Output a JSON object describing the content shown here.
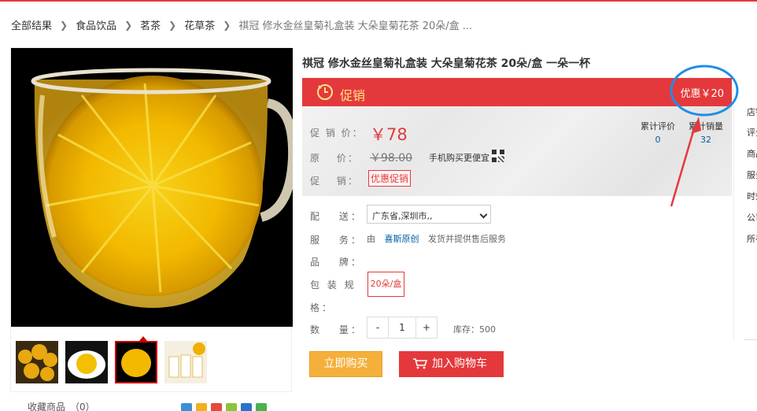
{
  "breadcrumb": [
    "全部结果",
    "食品饮品",
    "茗茶",
    "花草茶",
    "祺冠 修水金丝皇菊礼盒装 大朵皇菊花茶 20朵/盒 ..."
  ],
  "product": {
    "title": "祺冠 修水金丝皇菊礼盒装 大朵皇菊花茶 20朵/盒 一朵一杯",
    "promo_label": "促销",
    "discount_badge": "优惠￥20",
    "price_label": "促 销 价：",
    "price": "￥78",
    "original_label": "原　 价：",
    "original_price": "￥98.00",
    "mobile_cheaper": "手机购买更便宜",
    "promo_row_label": "促　 销：",
    "promo_tag": "优惠促销",
    "review_label": "累计评价",
    "review_count": "0",
    "sales_label": "累计销量",
    "sales_count": "32"
  },
  "options": {
    "delivery_label": "配　 送：",
    "delivery_value": "广东省,深圳市,,",
    "service_label": "服　 务：",
    "service_prefix": "由",
    "service_shop": "喜斯原创",
    "service_suffix": "发货并提供售后服务",
    "brand_label": "品　 牌：",
    "spec_label_line1": "包 装 规",
    "spec_label_line2": "格：",
    "spec_value": "20朵/盒",
    "qty_label": "数　 量：",
    "qty_minus": "-",
    "qty_value": "1",
    "qty_plus": "+",
    "stock": "库存：500"
  },
  "actions": {
    "buy_now": "立即购买",
    "add_cart": "加入购物车"
  },
  "gallery": {
    "favorite": "收藏商品　（0）"
  },
  "sidebar": [
    "店铺",
    "评分",
    "商品",
    "服务",
    "时效",
    "公司",
    "所在"
  ],
  "colors": {
    "brand_red": "#e4393c",
    "buy_orange": "#f5b03b",
    "link_blue": "#005ea7",
    "annotation_blue": "#1e8ee8"
  }
}
